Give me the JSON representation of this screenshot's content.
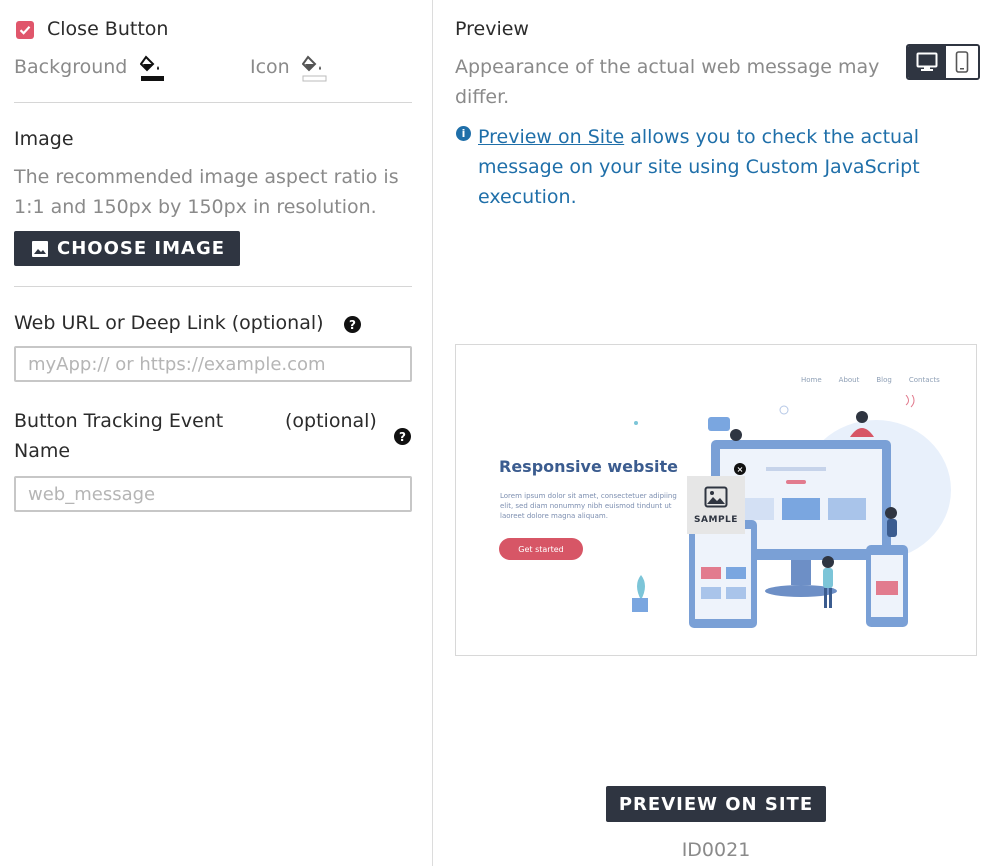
{
  "close_button": {
    "label": "Close Button",
    "checked": true,
    "background_label": "Background",
    "icon_label": "Icon"
  },
  "image_section": {
    "title": "Image",
    "description_line1": "The recommended image aspect ratio is",
    "description_line2": "1:1 and 150px by 150px in resolution.",
    "choose_label": "CHOOSE IMAGE"
  },
  "web_url": {
    "label": "Web URL or Deep Link (optional)",
    "placeholder": "myApp:// or https://example.com"
  },
  "tracking": {
    "label_line1": "Button Tracking Event",
    "label_optional": "(optional)",
    "label_line2": "Name",
    "placeholder": "web_message"
  },
  "preview": {
    "title": "Preview",
    "note_line1": "Appearance of the actual web message may",
    "note_line2": "differ.",
    "info_link": "Preview on Site",
    "info_rest1": "allows you to check the actual",
    "info_line2": "message on your site using Custom JavaScript",
    "info_line3": "execution.",
    "mock": {
      "nav": [
        "Home",
        "About",
        "Blog",
        "Contacts"
      ],
      "headline": "Responsive website",
      "body_line1": "Lorem ipsum dolor sit amet, consectetuer adipiing",
      "body_line2": "elit, sed diam nonummy nibh euismod tindunt ut",
      "body_line3": "laoreet dolore magna aliquam.",
      "cta": "Get started",
      "sample_label": "SAMPLE"
    },
    "preview_button": "PREVIEW ON SITE",
    "id": "ID0021"
  },
  "colors": {
    "accent": "#e0566b",
    "dark": "#2f3541",
    "link": "#1f6fa9"
  }
}
